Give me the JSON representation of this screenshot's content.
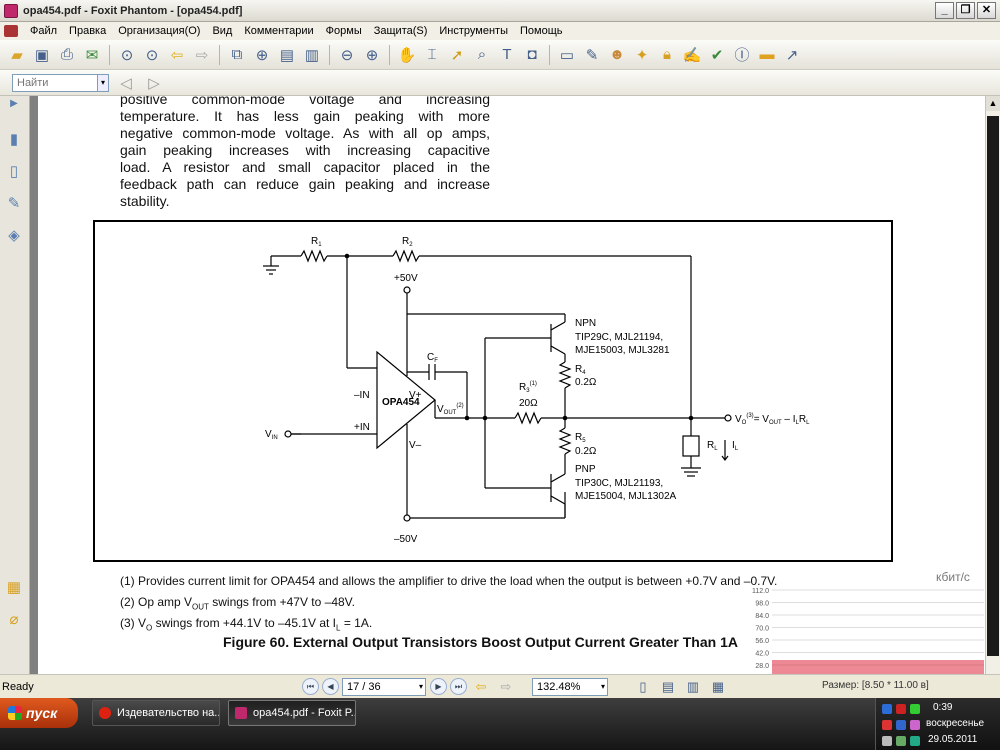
{
  "window": {
    "title": "opa454.pdf - Foxit Phantom - [opa454.pdf]"
  },
  "menu": [
    "Файл",
    "Правка",
    "Организация(O)",
    "Вид",
    "Комментарии",
    "Формы",
    "Защита(S)",
    "Инструменты",
    "Помощь"
  ],
  "search": {
    "placeholder": "Найти"
  },
  "document": {
    "paragraph_lines": [
      "positive common-mode voltage and increasing",
      "temperature. It has less gain peaking with more",
      "negative common-mode voltage. As with all op amps,",
      "gain peaking increases with increasing capacitive",
      "load. A resistor and small capacitor placed in the",
      "feedback path can reduce gain peaking and increase",
      "stability."
    ],
    "circuit": {
      "r1": "R",
      "r1_sub": "1",
      "r2": "R",
      "r2_sub": "2",
      "plus50": "+50V",
      "minus50": "–50V",
      "npn": "NPN",
      "npn_parts_1": "TIP29C, MJL21194,",
      "npn_parts_2": "MJE15003, MJL3281",
      "r4": "R",
      "r4_sub": "4",
      "r4_val": "0.2Ω",
      "cf": "C",
      "cf_sub": "F",
      "minus_in": "–IN",
      "plus_in": "+IN",
      "vplus": "V+",
      "vminus": "V–",
      "opamp": "OPA454",
      "vout": "V",
      "vout_sub": "OUT",
      "vout_sup": "(2)",
      "r3": "R",
      "r3_sub": "3",
      "r3_sup": "(1)",
      "r3_val": "20Ω",
      "vo": "V",
      "vo_sub": "O",
      "vo_sup": "(3)",
      "vo_eq": "= V",
      "vo_eq_sub": "OUT",
      "vo_eq_rest": " – I",
      "vo_eq_l": "L",
      "vo_eq_r": "R",
      "vo_eq_l2": "L",
      "r5": "R",
      "r5_sub": "5",
      "r5_val": "0.2Ω",
      "pnp": "PNP",
      "pnp_parts_1": "TIP30C, MJL21193,",
      "pnp_parts_2": "MJE15004, MJL1302A",
      "rl": "R",
      "rl_sub": "L",
      "il": "I",
      "il_sub": "L",
      "vin": "V",
      "vin_sub": "IN"
    },
    "notes": [
      "(1)  Provides current limit for OPA454 and allows the amplifier to drive the load when the output is between +0.7V and –0.7V.",
      "(2)  Op amp V",
      "(3)  V"
    ],
    "note2_sub": "OUT",
    "note2_rest": " swings from +47V to –48V.",
    "note3_sub": "O",
    "note3_rest": " swings from +44.1V to –45.1V at I",
    "note3_sub2": "L",
    "note3_rest2": " = 1A.",
    "figure_caption": "Figure 60. External Output Transistors Boost Output Current Greater Than 1A"
  },
  "net_meter": {
    "unit": "кбит/с",
    "ticks": [
      "112.0",
      "98.0",
      "84.0",
      "70.0",
      "56.0",
      "42.0",
      "28.0",
      "14.0",
      "0.0"
    ],
    "level": 0.3
  },
  "status": {
    "ready": "Ready",
    "page": "17 / 36",
    "zoom": "132.48%",
    "size": "Размер: [8.50 * 11.00 в]"
  },
  "taskbar": {
    "start": "пуск",
    "tasks": [
      "Издевательство на...",
      "opa454.pdf - Foxit P..."
    ],
    "time": "0:39",
    "day": "воскресенье",
    "date": "29.05.2011"
  }
}
